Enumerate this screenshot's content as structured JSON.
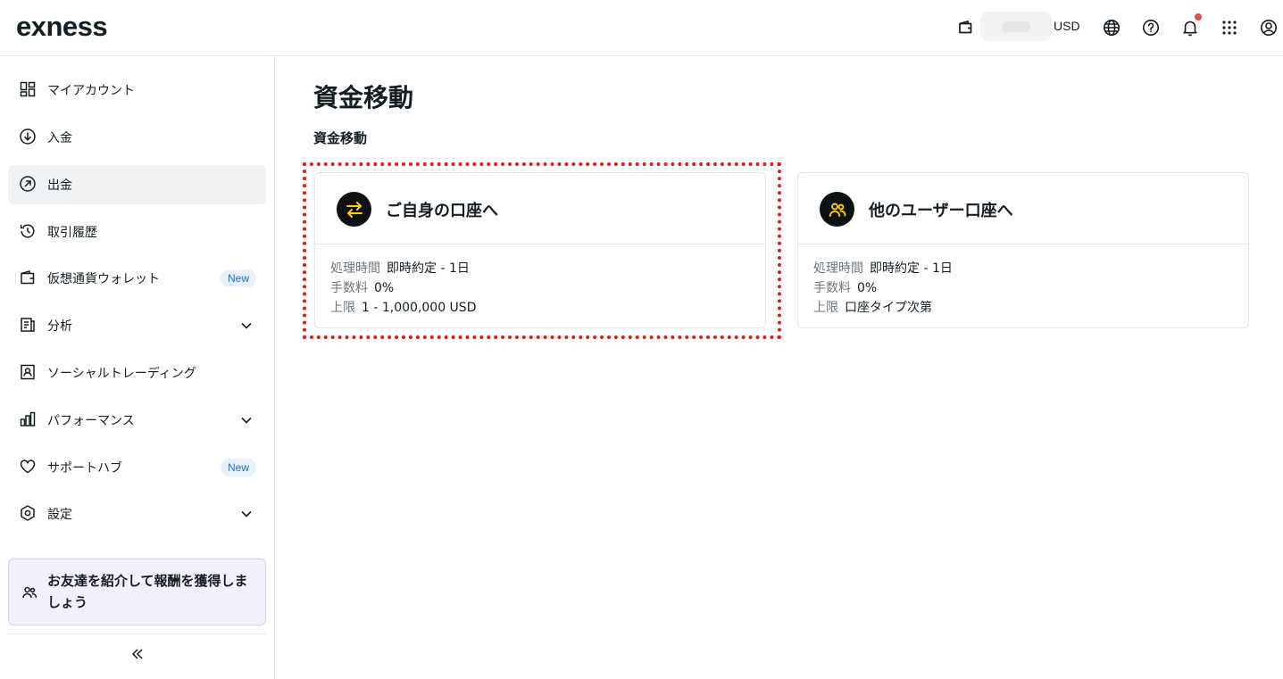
{
  "header": {
    "logo": "exness",
    "currency": "USD",
    "icons": [
      "wallet-icon",
      "globe-icon",
      "help-icon",
      "bell-icon",
      "apps-grid-icon",
      "profile-icon"
    ],
    "notification_dot_color": "#e5484d"
  },
  "sidebar": {
    "items": [
      {
        "label": "マイアカウント",
        "icon": "dashboard-icon"
      },
      {
        "label": "入金",
        "icon": "deposit-icon"
      },
      {
        "label": "出金",
        "icon": "withdraw-icon",
        "active": true
      },
      {
        "label": "取引履歴",
        "icon": "history-icon"
      },
      {
        "label": "仮想通貨ウォレット",
        "icon": "wallet-icon",
        "badge": "New"
      },
      {
        "label": "分析",
        "icon": "analytics-icon",
        "expandable": true
      },
      {
        "label": "ソーシャルトレーディング",
        "icon": "social-trading-icon"
      },
      {
        "label": "パフォーマンス",
        "icon": "performance-icon",
        "expandable": true
      },
      {
        "label": "サポートハブ",
        "icon": "heart-icon",
        "badge": "New"
      },
      {
        "label": "設定",
        "icon": "settings-icon",
        "expandable": true
      }
    ],
    "promo": "お友達を紹介して報酬を獲得しましょう"
  },
  "main": {
    "page_title": "資金移動",
    "section_title": "資金移動",
    "cards": [
      {
        "title": "ご自身の口座へ",
        "icon": "transfer-arrows-icon",
        "rows": [
          {
            "label": "処理時間",
            "value": "即時約定 - 1日"
          },
          {
            "label": "手数料",
            "value": "0%"
          },
          {
            "label": "上限",
            "value": "1 - 1,000,000 USD"
          }
        ]
      },
      {
        "title": "他のユーザー口座へ",
        "icon": "users-icon",
        "rows": [
          {
            "label": "処理時間",
            "value": "即時約定 - 1日"
          },
          {
            "label": "手数料",
            "value": "0%"
          },
          {
            "label": "上限",
            "value": "口座タイプ次第"
          }
        ]
      }
    ],
    "accent_color": "#ffcf00",
    "highlight_color": "#e3191c"
  }
}
